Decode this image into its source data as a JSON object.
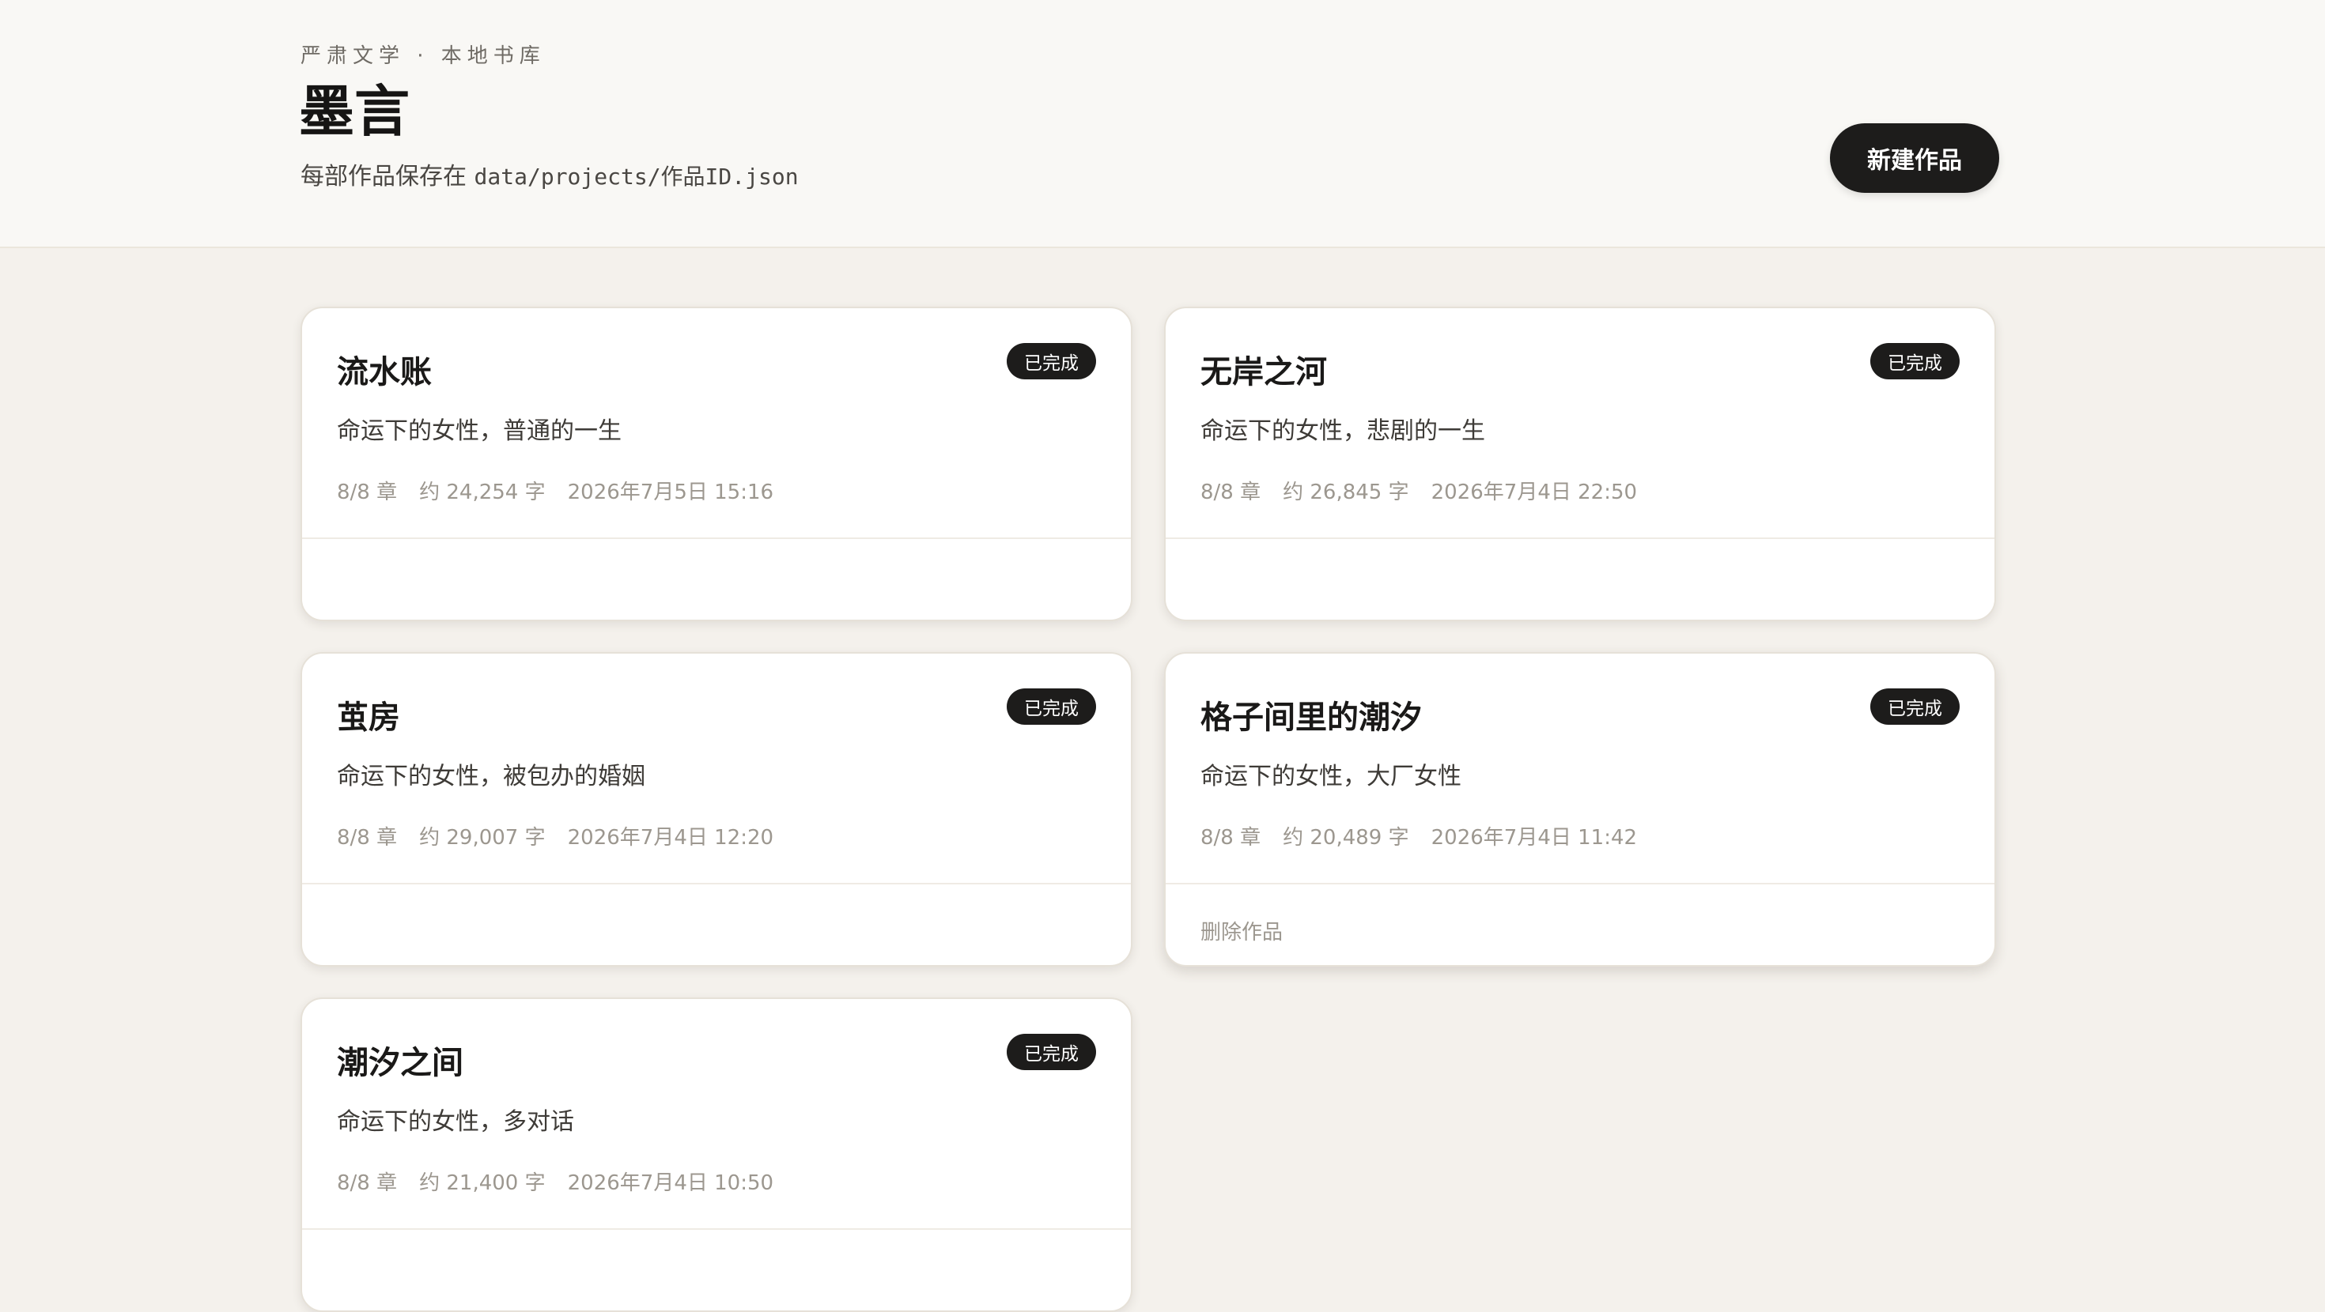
{
  "header": {
    "eyebrow": "严肃文学 · 本地书库",
    "title": "墨言",
    "subtitle_prefix": "每部作品保存在 ",
    "subtitle_path": "data/projects/作品ID.json",
    "new_button": "新建作品"
  },
  "projects": [
    {
      "title": "流水账",
      "status": "已完成",
      "description": "命运下的女性，普通的一生",
      "chapters": "8/8 章",
      "words": "约 24,254 字",
      "updated": "2026年7月5日 15:16",
      "delete_label": ""
    },
    {
      "title": "无岸之河",
      "status": "已完成",
      "description": "命运下的女性，悲剧的一生",
      "chapters": "8/8 章",
      "words": "约 26,845 字",
      "updated": "2026年7月4日 22:50",
      "delete_label": ""
    },
    {
      "title": "茧房",
      "status": "已完成",
      "description": "命运下的女性，被包办的婚姻",
      "chapters": "8/8 章",
      "words": "约 29,007 字",
      "updated": "2026年7月4日 12:20",
      "delete_label": ""
    },
    {
      "title": "格子间里的潮汐",
      "status": "已完成",
      "description": "命运下的女性，大厂女性",
      "chapters": "8/8 章",
      "words": "约 20,489 字",
      "updated": "2026年7月4日 11:42",
      "delete_label": "删除作品"
    },
    {
      "title": "潮汐之间",
      "status": "已完成",
      "description": "命运下的女性，多对话",
      "chapters": "8/8 章",
      "words": "约 21,400 字",
      "updated": "2026年7月4日 10:50",
      "delete_label": ""
    }
  ]
}
